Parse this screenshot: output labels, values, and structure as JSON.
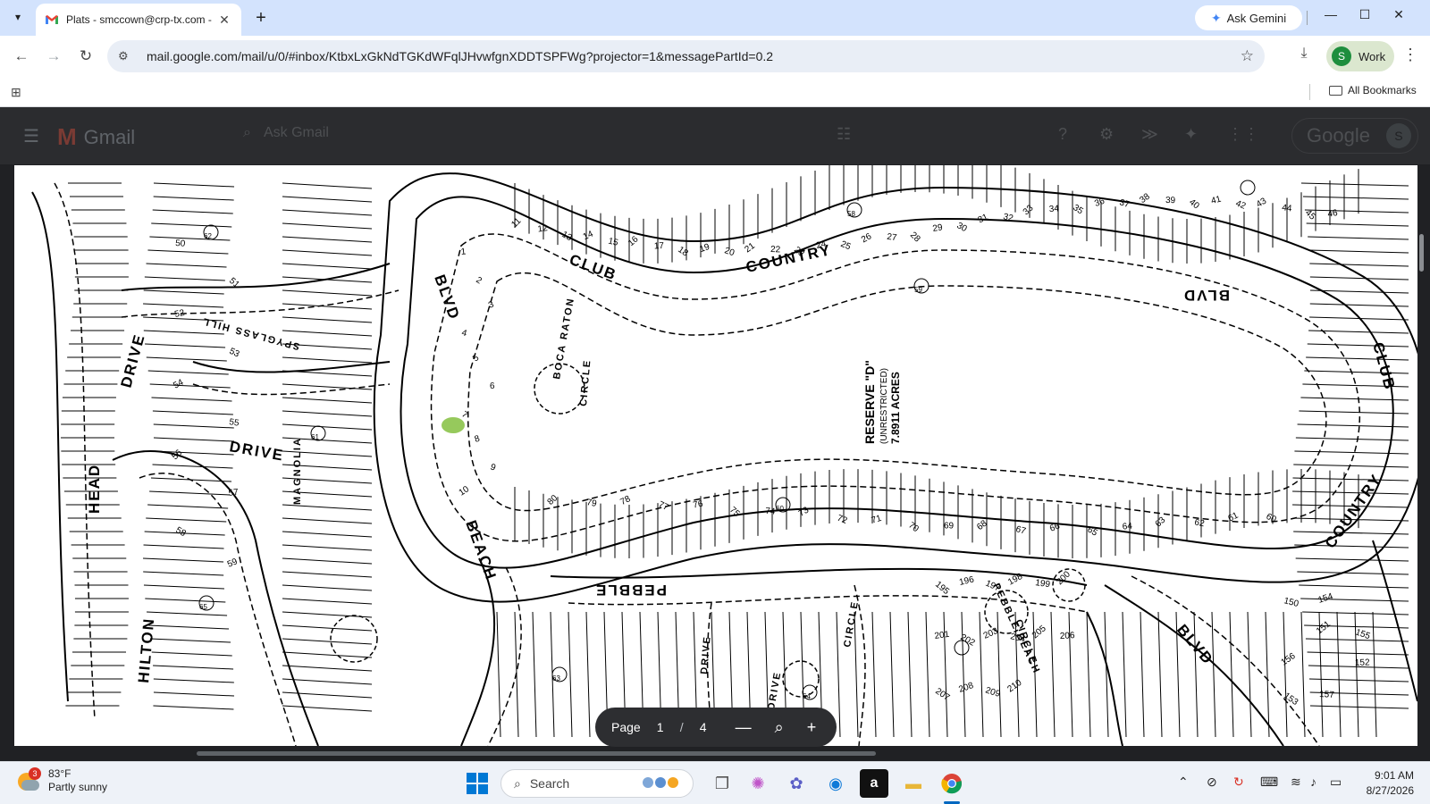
{
  "browser": {
    "tab": {
      "title": "Plats - smccown@crp-tx.com - ",
      "favicon": "gmail-icon"
    },
    "new_tab": "+",
    "gemini": {
      "label": "Ask Gemini",
      "icon": "gemini-spark-icon"
    },
    "url": "mail.google.com/mail/u/0/#inbox/KtbxLxGkNdTGKdWFqlJHvwfgnXDDTSPFWg?projector=1&messagePartId=0.2",
    "profile": {
      "initial": "S",
      "label": "Work",
      "color": "#1e8e3e"
    },
    "bookmarks_label": "All Bookmarks"
  },
  "gmail": {
    "logo_text": "Gmail",
    "search_placeholder": "Ask Gmail",
    "google_text": "Google",
    "avatar_initial": "S"
  },
  "plat": {
    "reserve_title": "RESERVE \"D\"",
    "reserve_sub1": "(UNRESTRICTED)",
    "reserve_sub2": "7.8911 ACRES",
    "streets": [
      "COUNTRY",
      "CLUB",
      "BLVD",
      "PEBBLE",
      "BEACH",
      "BLVD",
      "DRIVE",
      "DRIVE",
      "HEAD",
      "HILTON",
      "COUNTRY",
      "CLUB",
      "BLVD",
      "BOCA RATON",
      "CIRCLE",
      "DRIVE",
      "CIRCLE",
      "PEBBLE BEACH",
      "CIRCLE",
      "DRIVE",
      "SPYGLASS HILL",
      "MAGNOLIA"
    ],
    "lot_numbers": [
      "11",
      "12",
      "13",
      "14",
      "15",
      "16",
      "17",
      "18",
      "19",
      "20",
      "21",
      "22",
      "23",
      "24",
      "25",
      "26",
      "27",
      "28",
      "29",
      "30",
      "31",
      "32",
      "33",
      "34",
      "35",
      "36",
      "37",
      "38",
      "39",
      "40",
      "41",
      "42",
      "43",
      "44",
      "45",
      "46",
      "60",
      "61",
      "62",
      "63",
      "64",
      "65",
      "66",
      "67",
      "68",
      "69",
      "70",
      "71",
      "72",
      "73",
      "74",
      "75",
      "76",
      "77",
      "78",
      "79",
      "80",
      "1",
      "2",
      "3",
      "4",
      "5",
      "6",
      "7",
      "8",
      "9",
      "10",
      "50",
      "51",
      "52",
      "53",
      "54",
      "55",
      "56",
      "57",
      "58",
      "59",
      "150",
      "151",
      "152",
      "153",
      "154",
      "155",
      "156",
      "157",
      "195",
      "196",
      "197",
      "198",
      "199",
      "200",
      "201",
      "202",
      "203",
      "204",
      "205",
      "206",
      "207",
      "208",
      "209",
      "210"
    ],
    "block_numbers": [
      "58",
      "59",
      "60",
      "61",
      "62",
      "63",
      "64",
      "65"
    ],
    "highlight_color": "#8bc34a"
  },
  "pager": {
    "label": "Page",
    "current": "1",
    "separator": "/",
    "total": "4",
    "zoom_out": "—",
    "zoom_icon": "zoom-icon",
    "zoom_in": "+"
  },
  "taskbar": {
    "weather_badge": "3",
    "weather_temp": "83°F",
    "weather_desc": "Partly sunny",
    "search_label": "Search",
    "time": "9:01 AM",
    "date": "8/27/2026"
  }
}
